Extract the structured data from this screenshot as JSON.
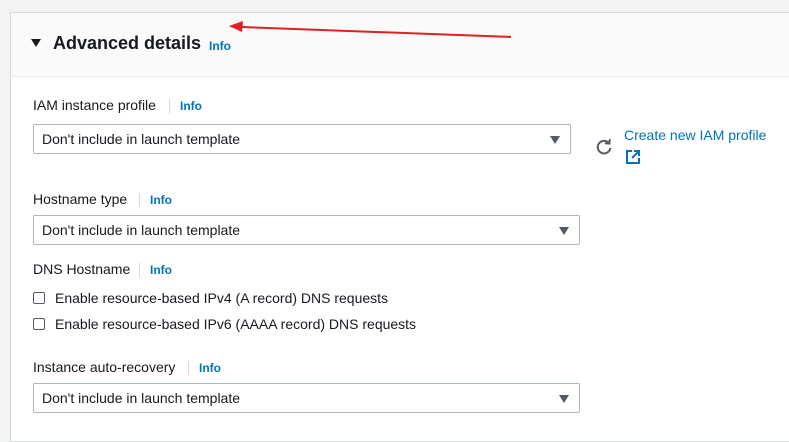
{
  "section": {
    "title": "Advanced details",
    "info": "Info"
  },
  "iam_profile": {
    "label": "IAM instance profile",
    "info": "Info",
    "selected": "Don't include in launch template",
    "create_link": "Create new IAM profile"
  },
  "hostname_type": {
    "label": "Hostname type",
    "info": "Info",
    "selected": "Don't include in launch template"
  },
  "dns_hostname": {
    "label": "DNS Hostname",
    "info": "Info",
    "options": [
      {
        "label": "Enable resource-based IPv4 (A record) DNS requests",
        "checked": false
      },
      {
        "label": "Enable resource-based IPv6 (AAAA record) DNS requests",
        "checked": false
      }
    ]
  },
  "auto_recovery": {
    "label": "Instance auto-recovery",
    "info": "Info",
    "selected": "Don't include in launch template"
  },
  "colors": {
    "link": "#0073bb",
    "annotation_arrow": "#e02020"
  }
}
